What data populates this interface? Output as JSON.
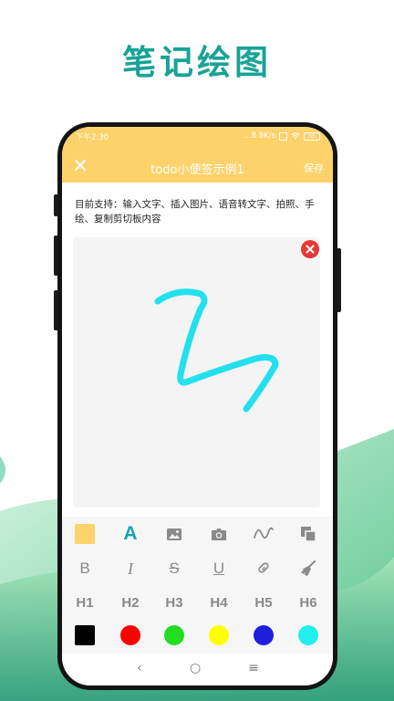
{
  "promo": {
    "title": "笔记绘图"
  },
  "status_bar": {
    "time": "下午2:30",
    "net_speed": "...8.8K/s",
    "battery": "55"
  },
  "app_bar": {
    "title": "todo小便签示例1",
    "save_label": "保存"
  },
  "content": {
    "support_text": "目前支持：输入文字、插入图片、语音转文字、拍照、手绘、复制剪切板内容"
  },
  "drawing": {
    "stroke_color": "#22e0ee"
  },
  "toolbar": {
    "row1": [
      "background-color-swatch",
      "text-color-icon",
      "image-icon",
      "camera-icon",
      "handwriting-icon",
      "copy-icon"
    ],
    "row2": [
      "B",
      "I",
      "S",
      "U"
    ],
    "headings": [
      "H1",
      "H2",
      "H3",
      "H4",
      "H5",
      "H6"
    ],
    "colors": [
      "#000000",
      "#ff0000",
      "#22dd22",
      "#ffff00",
      "#1e1edd",
      "#22eeee"
    ],
    "bg_swatch_color": "#fdd26b",
    "text_icon_color": "#17a3b8"
  },
  "nav": {
    "back": "‹",
    "home": "○",
    "menu": "≡"
  },
  "colors": {
    "accent": "#17a396",
    "header": "#fdd26b",
    "delete": "#e53935"
  }
}
